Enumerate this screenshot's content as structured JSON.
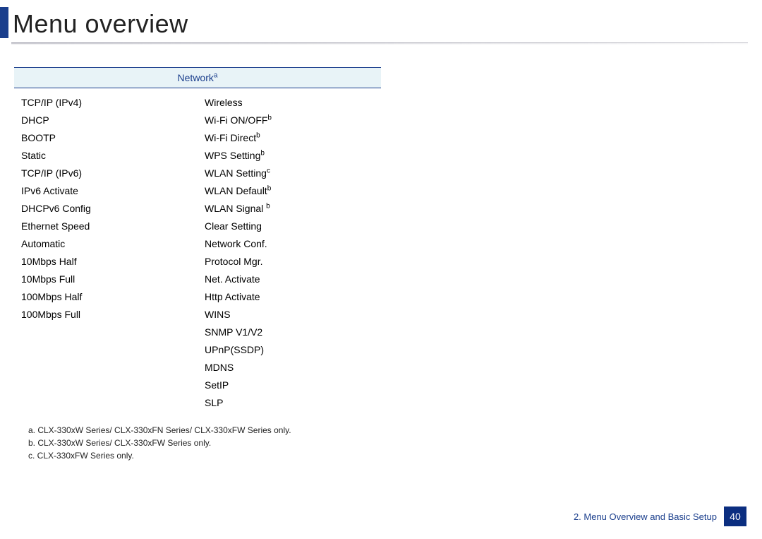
{
  "title": "Menu overview",
  "table_header": {
    "label": "Network",
    "sup": "a"
  },
  "columns": [
    [
      {
        "level": 1,
        "text": "TCP/IP (IPv4)"
      },
      {
        "level": 2,
        "text": "DHCP"
      },
      {
        "level": 2,
        "text": "BOOTP"
      },
      {
        "level": 2,
        "text": "Static"
      },
      {
        "level": 1,
        "text": "TCP/IP (IPv6)"
      },
      {
        "level": 2,
        "text": "IPv6 Activate"
      },
      {
        "level": 2,
        "text": "DHCPv6 Config"
      },
      {
        "level": 1,
        "text": "Ethernet Speed"
      },
      {
        "level": 2,
        "text": "Automatic"
      },
      {
        "level": 2,
        "text": "10Mbps Half"
      },
      {
        "level": 2,
        "text": "10Mbps Full"
      },
      {
        "level": 2,
        "text": "100Mbps Half"
      },
      {
        "level": 2,
        "text": "100Mbps Full"
      }
    ],
    [
      {
        "level": 1,
        "text": "Wireless"
      },
      {
        "level": 2,
        "text": "Wi-Fi ON/OFF",
        "sup": "b"
      },
      {
        "level": 2,
        "text": "Wi-Fi Direct",
        "sup": "b"
      },
      {
        "level": 2,
        "text": "WPS Setting",
        "sup": "b"
      },
      {
        "level": 2,
        "text": "WLAN Setting",
        "sup": "c"
      },
      {
        "level": 2,
        "text": "WLAN Default",
        "sup": "b"
      },
      {
        "level": 2,
        "text": "WLAN Signal ",
        "sup": "b"
      },
      {
        "level": 1,
        "text": "Clear Setting"
      },
      {
        "level": 1,
        "text": "Network Conf."
      },
      {
        "level": 1,
        "text": "Protocol Mgr."
      },
      {
        "level": 2,
        "text": "Net. Activate"
      },
      {
        "level": 2,
        "text": "Http Activate"
      },
      {
        "level": 2,
        "text": "WINS"
      },
      {
        "level": 2,
        "text": "SNMP V1/V2"
      },
      {
        "level": 2,
        "text": "UPnP(SSDP)"
      },
      {
        "level": 2,
        "text": "MDNS"
      },
      {
        "level": 2,
        "text": "SetIP"
      },
      {
        "level": 2,
        "text": "SLP"
      }
    ]
  ],
  "footnotes": [
    "a. CLX-330xW Series/ CLX-330xFN Series/ CLX-330xFW Series only.",
    "b. CLX-330xW Series/ CLX-330xFW Series only.",
    "c. CLX-330xFW Series only."
  ],
  "footer": {
    "chapter": "2. Menu Overview and Basic Setup",
    "page": "40"
  }
}
